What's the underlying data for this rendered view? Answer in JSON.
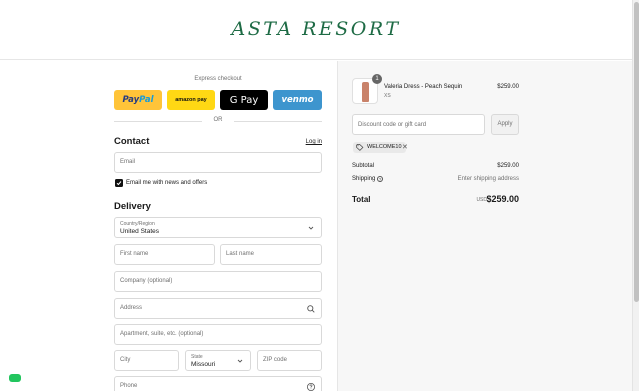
{
  "header": {
    "logo": "ASTA RESORT"
  },
  "express": {
    "label": "Express checkout",
    "buttons": {
      "paypal_a": "Pay",
      "paypal_b": "Pal",
      "amazon": "amazon pay",
      "gpay": "G Pay",
      "venmo": "venmo"
    },
    "or": "OR"
  },
  "contact": {
    "title": "Contact",
    "login": "Log in",
    "email_placeholder": "Email",
    "newsletter_label": "Email me with news and offers",
    "newsletter_checked": true
  },
  "delivery": {
    "title": "Delivery",
    "country_label": "Country/Region",
    "country_value": "United States",
    "first_name": "First name",
    "last_name": "Last name",
    "company": "Company (optional)",
    "address": "Address",
    "apartment": "Apartment, suite, etc. (optional)",
    "city": "City",
    "state_label": "State",
    "state_value": "Missouri",
    "zip": "ZIP code",
    "phone": "Phone"
  },
  "order": {
    "item": {
      "quantity": "1",
      "name": "Valeria Dress - Peach Sequin",
      "variant": "XS",
      "price": "$259.00"
    },
    "discount_placeholder": "Discount code or gift card",
    "apply": "Apply",
    "applied_code": "WELCOME10",
    "subtotal_label": "Subtotal",
    "subtotal_value": "$259.00",
    "shipping_label": "Shipping",
    "shipping_value": "Enter shipping address",
    "total_label": "Total",
    "total_currency": "USD",
    "total_value": "$259.00"
  },
  "colors": {
    "brand": "#1e6b45",
    "paypal": "#ffc439",
    "amazon": "#ffd814",
    "venmo": "#3d95ce"
  }
}
